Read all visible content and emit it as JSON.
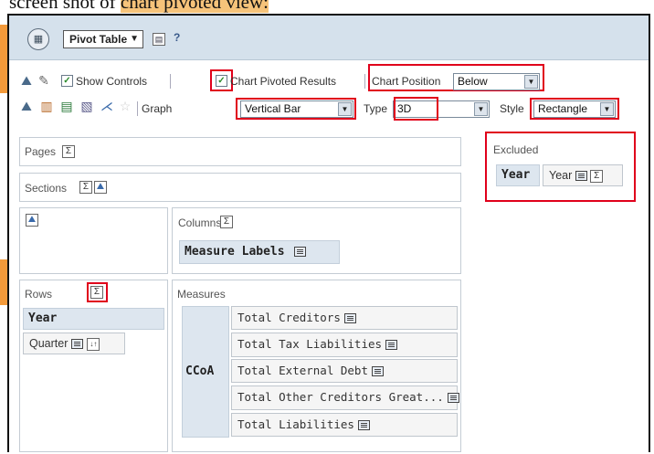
{
  "caption": {
    "before": "screen shot of ",
    "highlight": "chart pivoted view:"
  },
  "toolbar": {
    "view_dropdown": "Pivot Table",
    "help_glyph": "?"
  },
  "controls": {
    "show_controls_label": "Show Controls",
    "chart_pivoted_label": "Chart Pivoted Results",
    "chart_position_label": "Chart Position",
    "chart_position_value": "Below"
  },
  "graph": {
    "graph_label": "Graph",
    "graph_value": "Vertical Bar",
    "type_label": "Type",
    "type_value": "3D",
    "style_label": "Style",
    "style_value": "Rectangle"
  },
  "layout": {
    "pages_label": "Pages",
    "sections_label": "Sections",
    "columns_label": "Columns",
    "columns_item": "Measure Labels",
    "rows_label": "Rows",
    "rows_items": [
      "Year",
      "Quarter"
    ],
    "measures_label": "Measures",
    "measures_group": "CCoA",
    "measures_items": [
      "Total Creditors",
      "Total Tax Liabilities",
      "Total External Debt",
      "Total Other Creditors Great...",
      "Total Liabilities"
    ],
    "excluded_label": "Excluded",
    "excluded_header": "Year",
    "excluded_item": "Year"
  },
  "symbols": {
    "sigma": "Σ",
    "dropdown_arrow": "▼",
    "sort": "↓↑"
  },
  "colors": {
    "highlight_red": "#e0001b",
    "header_bg": "#d5e1ec",
    "chip_bg": "#dde6ef",
    "accent_orange": "#f39a3a"
  }
}
